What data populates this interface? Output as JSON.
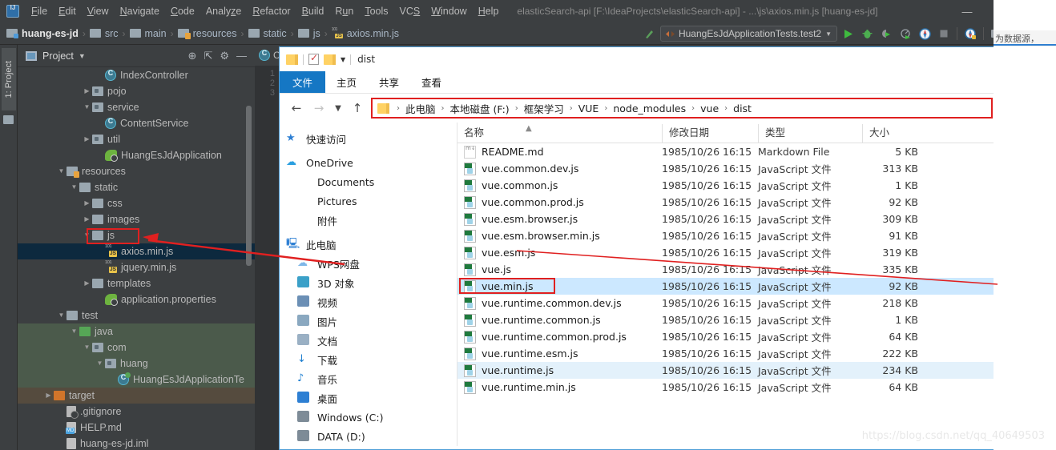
{
  "ide": {
    "window_title": "elasticSearch-api [F:\\IdeaProjects\\elasticSearch-api] - ...\\js\\axios.min.js [huang-es-jd]",
    "logo": "IJ",
    "menus": [
      "File",
      "Edit",
      "View",
      "Navigate",
      "Code",
      "Analyze",
      "Refactor",
      "Build",
      "Run",
      "Tools",
      "VCS",
      "Window",
      "Help"
    ],
    "window_buttons": {
      "minimize": "—",
      "maximize": "▢",
      "close": "✕"
    },
    "breadcrumb": [
      {
        "label": "huang-es-jd",
        "icon": "module-folder-icon"
      },
      {
        "label": "src",
        "icon": "folder-icon"
      },
      {
        "label": "main",
        "icon": "folder-icon"
      },
      {
        "label": "resources",
        "icon": "resources-folder-icon"
      },
      {
        "label": "static",
        "icon": "folder-icon"
      },
      {
        "label": "js",
        "icon": "folder-icon"
      },
      {
        "label": "axios.min.js",
        "icon": "javascript-file-icon"
      }
    ],
    "toolbar": {
      "run_configuration": "HuangEsJdApplicationTests.test2",
      "icons": [
        "build-icon",
        "run-icon",
        "debug-icon",
        "run-coverage-icon",
        "profile-icon",
        "idea-icon",
        "stop-icon",
        "update-icon",
        "project-structure-icon",
        "terminal-icon",
        "search-icon"
      ]
    },
    "project_tool_window": {
      "tab_label": "1: Project",
      "title": "Project",
      "header_icons": [
        "locate-icon",
        "collapse-all-icon",
        "settings-icon",
        "hide-icon"
      ]
    },
    "tree": [
      {
        "label": "IndexController",
        "icon": "java-class-icon",
        "indent": 6,
        "twisty": "",
        "state": ""
      },
      {
        "label": "pojo",
        "icon": "package-folder-icon",
        "indent": 5,
        "twisty": "collapsed",
        "state": ""
      },
      {
        "label": "service",
        "icon": "package-folder-icon",
        "indent": 5,
        "twisty": "expanded",
        "state": ""
      },
      {
        "label": "ContentService",
        "icon": "java-class-icon",
        "indent": 6,
        "twisty": "",
        "state": ""
      },
      {
        "label": "util",
        "icon": "package-folder-icon",
        "indent": 5,
        "twisty": "collapsed",
        "state": ""
      },
      {
        "label": "HuangEsJdApplication",
        "icon": "spring-boot-icon",
        "indent": 6,
        "twisty": "",
        "state": ""
      },
      {
        "label": "resources",
        "icon": "resources-folder-icon",
        "indent": 3,
        "twisty": "expanded",
        "state": ""
      },
      {
        "label": "static",
        "icon": "folder-icon",
        "indent": 4,
        "twisty": "expanded",
        "state": ""
      },
      {
        "label": "css",
        "icon": "folder-icon",
        "indent": 5,
        "twisty": "collapsed",
        "state": ""
      },
      {
        "label": "images",
        "icon": "folder-icon",
        "indent": 5,
        "twisty": "collapsed",
        "state": ""
      },
      {
        "label": "js",
        "icon": "folder-icon",
        "indent": 5,
        "twisty": "expanded",
        "state": "highlighted"
      },
      {
        "label": "axios.min.js",
        "icon": "javascript-file-icon",
        "indent": 6,
        "twisty": "",
        "state": "selected"
      },
      {
        "label": "jquery.min.js",
        "icon": "javascript-file-icon",
        "indent": 6,
        "twisty": "",
        "state": ""
      },
      {
        "label": "templates",
        "icon": "folder-icon",
        "indent": 5,
        "twisty": "collapsed",
        "state": ""
      },
      {
        "label": "application.properties",
        "icon": "spring-properties-icon",
        "indent": 6,
        "twisty": "",
        "state": ""
      },
      {
        "label": "test",
        "icon": "folder-icon",
        "indent": 3,
        "twisty": "expanded",
        "state": ""
      },
      {
        "label": "java",
        "icon": "test-source-folder-icon",
        "indent": 4,
        "twisty": "expanded",
        "state": "green"
      },
      {
        "label": "com",
        "icon": "package-folder-icon",
        "indent": 5,
        "twisty": "expanded",
        "state": "green"
      },
      {
        "label": "huang",
        "icon": "package-folder-icon",
        "indent": 6,
        "twisty": "expanded",
        "state": "green"
      },
      {
        "label": "HuangEsJdApplicationTe",
        "icon": "java-test-class-icon",
        "indent": 7,
        "twisty": "",
        "state": "green"
      },
      {
        "label": "target",
        "icon": "excluded-folder-icon",
        "indent": 2,
        "twisty": "collapsed",
        "state": "brown"
      },
      {
        "label": ".gitignore",
        "icon": "gitignore-icon",
        "indent": 3,
        "twisty": "",
        "state": ""
      },
      {
        "label": "HELP.md",
        "icon": "markdown-icon",
        "indent": 3,
        "twisty": "",
        "state": ""
      },
      {
        "label": "huang-es-jd.iml",
        "icon": "iml-icon",
        "indent": 3,
        "twisty": "",
        "state": ""
      }
    ],
    "editor": {
      "tab_label": "C",
      "line_numbers": [
        "1",
        "2",
        "3"
      ]
    }
  },
  "explorer": {
    "title": "dist",
    "quick_access_icons": [
      "folder-icon",
      "properties-icon",
      "folder-icon",
      "customize-caret-icon"
    ],
    "ribbon_tabs": [
      "文件",
      "主页",
      "共享",
      "查看"
    ],
    "address": {
      "back_icon": "back-arrow-icon",
      "forward_icon": "forward-arrow-icon",
      "recent_icon": "recent-locations-icon",
      "up_icon": "up-arrow-icon",
      "crumbs": [
        "此电脑",
        "本地磁盘 (F:)",
        "框架学习",
        "VUE",
        "node_modules",
        "vue",
        "dist"
      ]
    },
    "nav_pane": [
      {
        "label": "快速访问",
        "icon": "quick-access-star-icon",
        "level": 0
      },
      {
        "label": "OneDrive",
        "icon": "onedrive-cloud-icon",
        "level": 0
      },
      {
        "label": "Documents",
        "icon": "folder-icon",
        "level": 1
      },
      {
        "label": "Pictures",
        "icon": "folder-icon",
        "level": 1
      },
      {
        "label": "附件",
        "icon": "folder-icon",
        "level": 1
      },
      {
        "label": "此电脑",
        "icon": "this-pc-icon",
        "level": 0
      },
      {
        "label": "WPS网盘",
        "icon": "wps-cloud-icon",
        "level": 1
      },
      {
        "label": "3D 对象",
        "icon": "3d-objects-icon",
        "level": 1
      },
      {
        "label": "视频",
        "icon": "videos-icon",
        "level": 1
      },
      {
        "label": "图片",
        "icon": "pictures-icon",
        "level": 1
      },
      {
        "label": "文档",
        "icon": "documents-icon",
        "level": 1
      },
      {
        "label": "下载",
        "icon": "downloads-icon",
        "level": 1
      },
      {
        "label": "音乐",
        "icon": "music-icon",
        "level": 1
      },
      {
        "label": "桌面",
        "icon": "desktop-icon",
        "level": 1
      },
      {
        "label": "Windows (C:)",
        "icon": "windows-drive-icon",
        "level": 1
      },
      {
        "label": "DATA (D:)",
        "icon": "drive-icon",
        "level": 1
      }
    ],
    "columns": [
      "名称",
      "修改日期",
      "类型",
      "大小"
    ],
    "sort_indicator": "▲",
    "files": [
      {
        "name": "README.md",
        "date": "1985/10/26 16:15",
        "type": "Markdown File",
        "size": "5 KB",
        "icon": "markdown-file-icon",
        "state": ""
      },
      {
        "name": "vue.common.dev.js",
        "date": "1985/10/26 16:15",
        "type": "JavaScript 文件",
        "size": "313 KB",
        "icon": "javascript-file-icon",
        "state": ""
      },
      {
        "name": "vue.common.js",
        "date": "1985/10/26 16:15",
        "type": "JavaScript 文件",
        "size": "1 KB",
        "icon": "javascript-file-icon",
        "state": ""
      },
      {
        "name": "vue.common.prod.js",
        "date": "1985/10/26 16:15",
        "type": "JavaScript 文件",
        "size": "92 KB",
        "icon": "javascript-file-icon",
        "state": ""
      },
      {
        "name": "vue.esm.browser.js",
        "date": "1985/10/26 16:15",
        "type": "JavaScript 文件",
        "size": "309 KB",
        "icon": "javascript-file-icon",
        "state": ""
      },
      {
        "name": "vue.esm.browser.min.js",
        "date": "1985/10/26 16:15",
        "type": "JavaScript 文件",
        "size": "91 KB",
        "icon": "javascript-file-icon",
        "state": ""
      },
      {
        "name": "vue.esm.js",
        "date": "1985/10/26 16:15",
        "type": "JavaScript 文件",
        "size": "319 KB",
        "icon": "javascript-file-icon",
        "state": ""
      },
      {
        "name": "vue.js",
        "date": "1985/10/26 16:15",
        "type": "JavaScript 文件",
        "size": "335 KB",
        "icon": "javascript-file-icon",
        "state": ""
      },
      {
        "name": "vue.min.js",
        "date": "1985/10/26 16:15",
        "type": "JavaScript 文件",
        "size": "92 KB",
        "icon": "javascript-file-icon",
        "state": "selected"
      },
      {
        "name": "vue.runtime.common.dev.js",
        "date": "1985/10/26 16:15",
        "type": "JavaScript 文件",
        "size": "218 KB",
        "icon": "javascript-file-icon",
        "state": ""
      },
      {
        "name": "vue.runtime.common.js",
        "date": "1985/10/26 16:15",
        "type": "JavaScript 文件",
        "size": "1 KB",
        "icon": "javascript-file-icon",
        "state": ""
      },
      {
        "name": "vue.runtime.common.prod.js",
        "date": "1985/10/26 16:15",
        "type": "JavaScript 文件",
        "size": "64 KB",
        "icon": "javascript-file-icon",
        "state": ""
      },
      {
        "name": "vue.runtime.esm.js",
        "date": "1985/10/26 16:15",
        "type": "JavaScript 文件",
        "size": "222 KB",
        "icon": "javascript-file-icon",
        "state": ""
      },
      {
        "name": "vue.runtime.js",
        "date": "1985/10/26 16:15",
        "type": "JavaScript 文件",
        "size": "234 KB",
        "icon": "javascript-file-icon",
        "state": "shaded"
      },
      {
        "name": "vue.runtime.min.js",
        "date": "1985/10/26 16:15",
        "type": "JavaScript 文件",
        "size": "64 KB",
        "icon": "javascript-file-icon",
        "state": ""
      }
    ]
  },
  "overlays": {
    "watermark": "https://blog.csdn.net/qq_40649503",
    "right_edge_text": "为数据源，",
    "annotation_color": "#e02020"
  }
}
